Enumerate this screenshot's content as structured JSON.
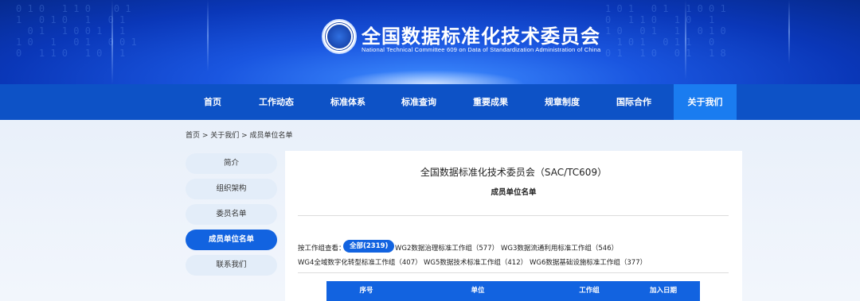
{
  "header": {
    "title": "全国数据标准化技术委员会",
    "subtitle": "National Technical Committee 609 on Data of Standardization Administration of China",
    "logo_icon": "committee-seal-icon"
  },
  "nav": {
    "items": [
      "首页",
      "工作动态",
      "标准体系",
      "标准查询",
      "重要成果",
      "规章制度",
      "国际合作",
      "关于我们"
    ],
    "active_index": 7
  },
  "breadcrumb": "首页 > 关于我们 > 成员单位名单",
  "sidebar": {
    "items": [
      "简介",
      "组织架构",
      "委员名单",
      "成员单位名单",
      "联系我们"
    ],
    "active_index": 3
  },
  "panel": {
    "title": "全国数据标准化技术委员会（SAC/TC609）",
    "subtitle": "成员单位名单",
    "filter_label": "按工作组查看：",
    "filters": [
      "全部(2319)",
      "WG2数据治理标准工作组（577）",
      "WG3数据流通利用标准工作组（546）",
      "WG4全域数字化转型标准工作组（407）",
      "WG5数据技术标准工作组（412）",
      "WG6数据基础设施标准工作组（377）"
    ],
    "active_filter": 0,
    "table_headers": [
      "序号",
      "单位",
      "工作组",
      "加入日期"
    ]
  },
  "colors": {
    "nav_bg": "#0d52c6",
    "nav_active": "#1a7cf0",
    "accent": "#1263e0"
  }
}
